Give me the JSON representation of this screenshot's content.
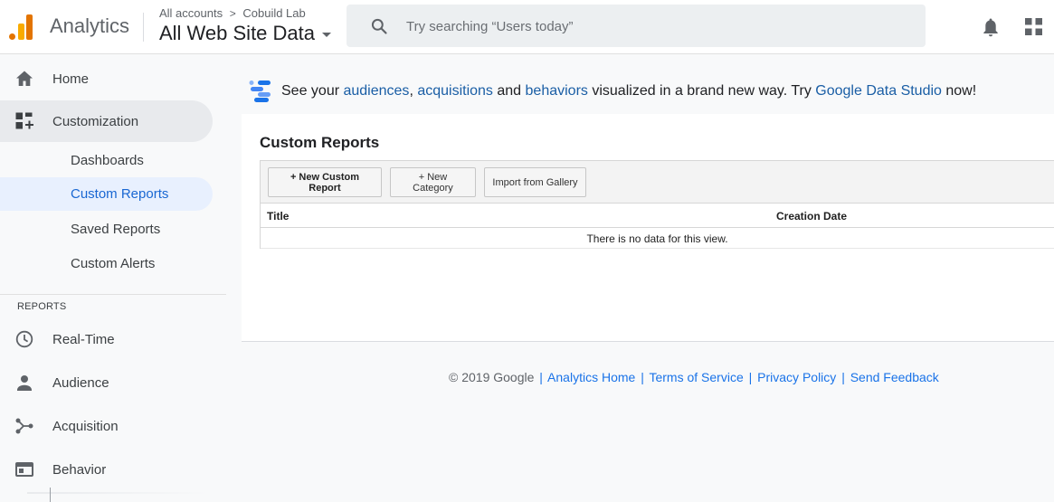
{
  "header": {
    "app_name": "Analytics",
    "breadcrumb_account": "All accounts",
    "breadcrumb_property": "Cobuild Lab",
    "breadcrumb_separator": ">",
    "view_name": "All Web Site Data",
    "search_placeholder": "Try searching “Users today”"
  },
  "sidebar": {
    "items": [
      {
        "label": "Home",
        "icon": "home-icon"
      },
      {
        "label": "Customization",
        "icon": "customization-icon"
      },
      {
        "label": "Dashboards"
      },
      {
        "label": "Custom Reports"
      },
      {
        "label": "Saved Reports"
      },
      {
        "label": "Custom Alerts"
      }
    ],
    "reports_heading": "REPORTS",
    "reports": [
      {
        "label": "Real-Time",
        "icon": "clock-icon"
      },
      {
        "label": "Audience",
        "icon": "person-icon"
      },
      {
        "label": "Acquisition",
        "icon": "acquisition-icon"
      },
      {
        "label": "Behavior",
        "icon": "behavior-icon"
      }
    ]
  },
  "banner": {
    "text_1": "See your ",
    "link_audiences": "audiences",
    "comma": ", ",
    "link_acquisitions": "acquisitions",
    "text_and": " and ",
    "link_behaviors": "behaviors",
    "text_2": " visualized in a brand new way. Try ",
    "link_datastudio": "Google Data Studio",
    "text_3": " now!"
  },
  "custom_reports": {
    "title": "Custom Reports",
    "buttons": {
      "new_report": "+ New Custom Report",
      "new_category": "+ New Category",
      "import": "Import from Gallery"
    },
    "columns": [
      "Title",
      "Creation Date"
    ],
    "empty_message": "There is no data for this view."
  },
  "footer": {
    "copyright": "© 2019 Google",
    "links": [
      "Analytics Home",
      "Terms of Service",
      "Privacy Policy",
      "Send Feedback"
    ],
    "separator": "|"
  },
  "colors": {
    "accent": "#1a73e8",
    "link": "#1a5ea5",
    "active_bg": "#e8f0fe",
    "logo_orange": "#e37400",
    "logo_yellow": "#f9ab00"
  }
}
